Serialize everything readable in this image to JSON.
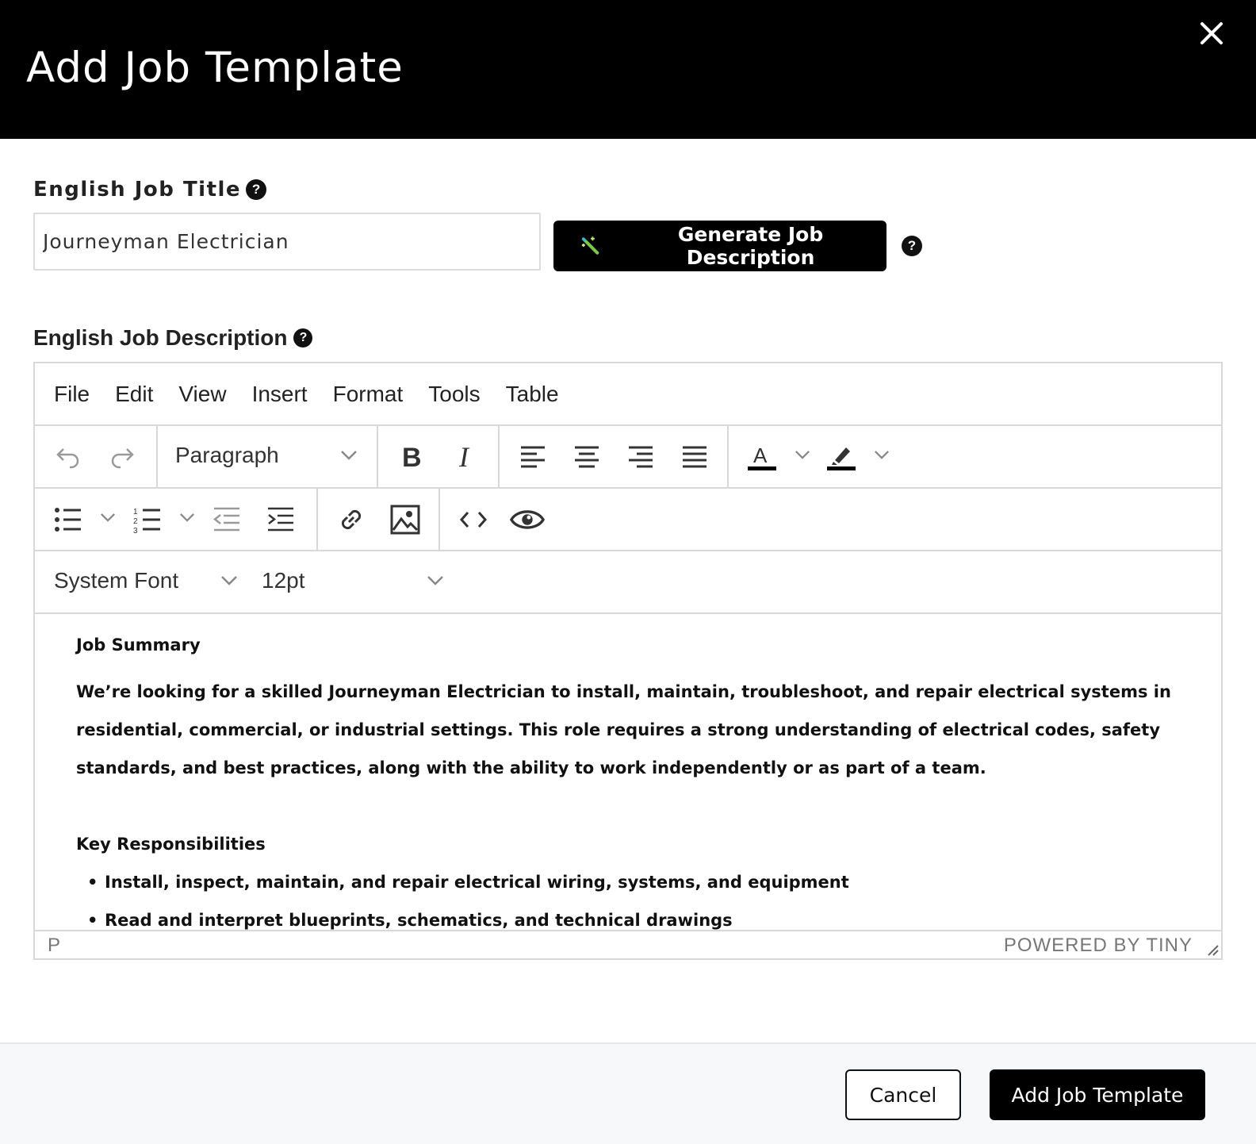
{
  "modal": {
    "title": "Add Job Template",
    "close_icon": "close-icon"
  },
  "job_title": {
    "label": "English Job Title",
    "value": "Journeyman Electrician",
    "help_icon": "question-circle-icon"
  },
  "generate_button": {
    "label": "Generate Job Description",
    "icon": "magic-wand-icon"
  },
  "job_description": {
    "label": "English Job Description",
    "help_icon": "question-circle-icon"
  },
  "editor": {
    "menu": [
      "File",
      "Edit",
      "View",
      "Insert",
      "Format",
      "Tools",
      "Table"
    ],
    "block_format": "Paragraph",
    "font_family": "System Font",
    "font_size": "12pt",
    "toolbar_icons": [
      "undo-icon",
      "redo-icon",
      "bold-icon",
      "italic-icon",
      "align-left-icon",
      "align-center-icon",
      "align-right-icon",
      "align-justify-icon",
      "text-color-icon",
      "highlight-icon",
      "bullet-list-icon",
      "numbered-list-icon",
      "outdent-icon",
      "indent-icon",
      "link-icon",
      "image-icon",
      "code-icon",
      "preview-icon"
    ],
    "text_color": "#000000",
    "highlight_color": "#000000",
    "content": {
      "heading1": "Job Summary",
      "summary": "We’re looking for a skilled Journeyman Electrician to install, maintain, troubleshoot, and repair electrical systems in residential, commercial, or industrial settings. This role requires a strong understanding of electrical codes, safety standards, and best practices, along with the ability to work independently or as part of a team.",
      "heading2": "Key Responsibilities",
      "responsibilities": [
        "Install, inspect, maintain, and repair electrical wiring, systems, and equipment",
        "Read and interpret blueprints, schematics, and technical drawings"
      ]
    },
    "status_path": "P",
    "powered_by": "POWERED BY TINY"
  },
  "footer": {
    "cancel_label": "Cancel",
    "submit_label": "Add Job Template"
  }
}
